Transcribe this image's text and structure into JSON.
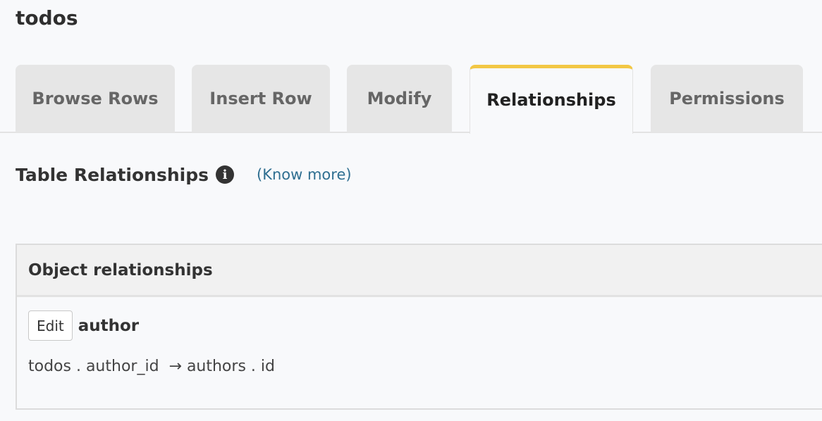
{
  "page": {
    "title": "todos"
  },
  "tabs": [
    {
      "label": "Browse Rows",
      "active": false
    },
    {
      "label": "Insert Row",
      "active": false
    },
    {
      "label": "Modify",
      "active": false
    },
    {
      "label": "Relationships",
      "active": true
    },
    {
      "label": "Permissions",
      "active": false
    }
  ],
  "section": {
    "title": "Table Relationships",
    "info_icon": "info-circle-icon",
    "link": "(Know more)"
  },
  "object_relationships": {
    "header": "Object relationships",
    "items": [
      {
        "edit_label": "Edit",
        "name": "author",
        "mapping": "todos . author_id  → authors . id"
      }
    ]
  },
  "colors": {
    "active_tab_accent": "#f2c744",
    "link": "#2f6f91",
    "tab_bg": "#e6e6e6",
    "page_bg": "#f8f9fb"
  }
}
